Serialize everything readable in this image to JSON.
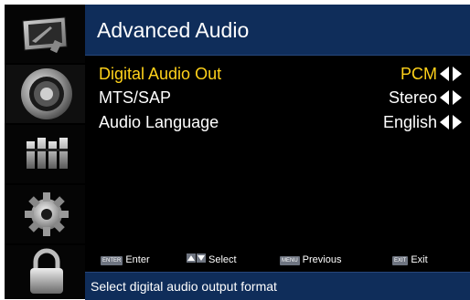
{
  "menu": {
    "title": "Advanced Audio",
    "items": [
      {
        "label": "Digital Audio Out",
        "value": "PCM",
        "selected": true
      },
      {
        "label": "MTS/SAP",
        "value": "Stereo",
        "selected": false
      },
      {
        "label": "Audio Language",
        "value": "English",
        "selected": false
      }
    ]
  },
  "sidebar": {
    "icons": [
      "picture-icon",
      "audio-speaker-icon",
      "channel-icon",
      "settings-gear-icon",
      "lock-icon"
    ],
    "active_index": 1
  },
  "hints": {
    "enter": {
      "key": "ENTER",
      "label": "Enter"
    },
    "select": {
      "label": "Select"
    },
    "previous": {
      "key": "MENU",
      "label": "Previous"
    },
    "exit": {
      "key": "EXIT",
      "label": "Exit"
    }
  },
  "status": "Select digital audio output format",
  "colors": {
    "highlight": "#ffd21a",
    "bar": "#0f2d5a",
    "background": "#000000"
  }
}
